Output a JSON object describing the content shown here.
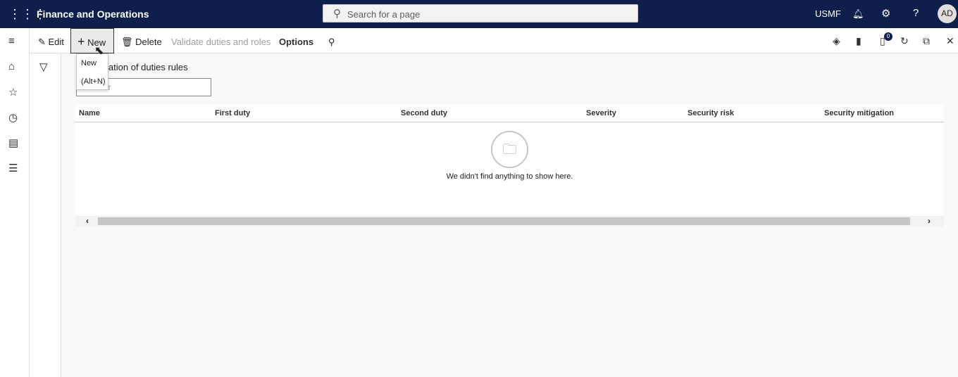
{
  "app": {
    "title": "Finance and Operations",
    "search_placeholder": "Search for a page",
    "company": "USMF",
    "avatar": "AD"
  },
  "toolbar": {
    "edit": "Edit",
    "new": "New",
    "delete": "Delete",
    "validate": "Validate duties and roles",
    "options": "Options",
    "notification_count": "0"
  },
  "tooltip": {
    "label": "New",
    "shortcut": "(Alt+N)"
  },
  "page": {
    "title": "Segregation of duties rules",
    "filter_placeholder": "Filter"
  },
  "grid": {
    "columns": [
      "Name",
      "First duty",
      "Second duty",
      "Severity",
      "Security risk",
      "Security mitigation"
    ],
    "empty_message": "We didn't find anything to show here."
  }
}
